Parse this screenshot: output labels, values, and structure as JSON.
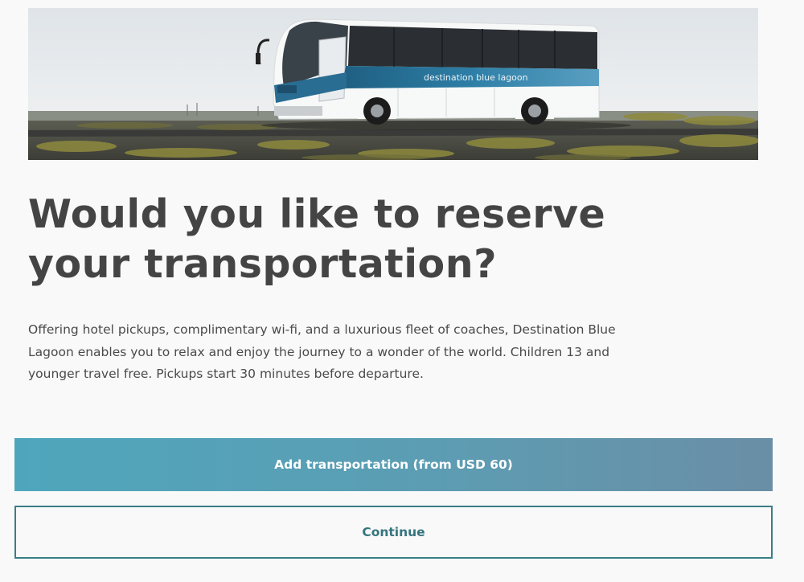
{
  "hero": {
    "bus_livery_text": "destination blue lagoon",
    "bus_sign_text": "destination blue lagoon"
  },
  "title": "Would you like to reserve your transportation?",
  "description": "Offering hotel pickups, complimentary wi-fi, and a luxurious fleet of coaches, Destination Blue Lagoon enables you to relax and enjoy the journey to a wonder of the world. Children 13 and younger travel free. Pickups start 30 minutes before departure.",
  "buttons": {
    "add_transportation": "Add transportation (from USD 60)",
    "continue": "Continue"
  },
  "colors": {
    "primary_gradient_start": "#4fa6bc",
    "primary_gradient_end": "#6a8ea6",
    "secondary_border": "#3b7d86",
    "heading": "#444444"
  }
}
